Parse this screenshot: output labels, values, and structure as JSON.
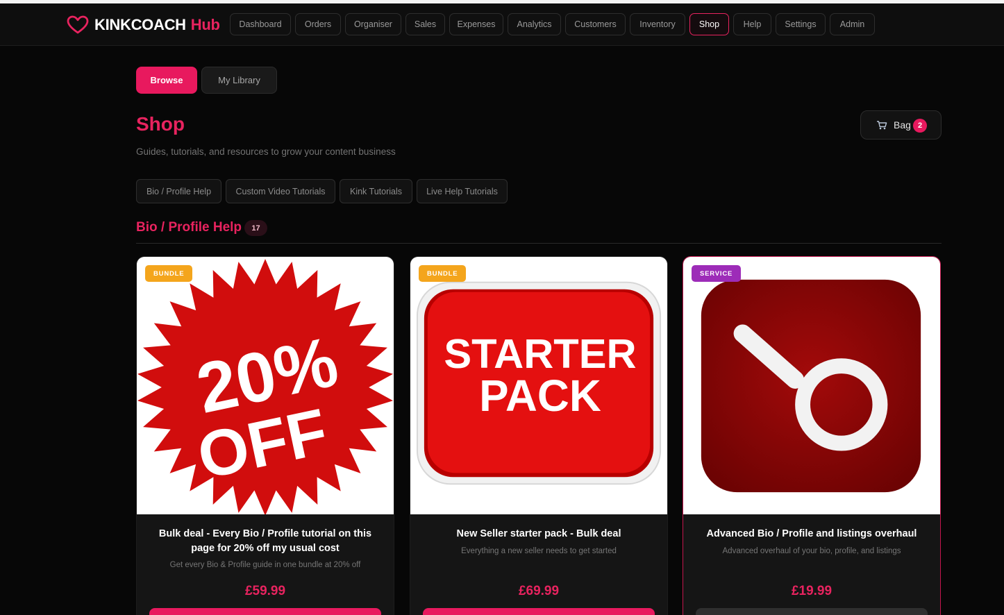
{
  "brand": {
    "name_white": "KINKCOACH",
    "name_pink": "Hub",
    "accent": "#e8235f",
    "icon": "heart-outline-icon"
  },
  "nav": {
    "items": [
      "Dashboard",
      "Orders",
      "Organiser",
      "Sales",
      "Expenses",
      "Analytics",
      "Customers",
      "Inventory",
      "Shop",
      "Help",
      "Settings",
      "Admin"
    ],
    "active": "Shop"
  },
  "tabs": {
    "browse": "Browse",
    "library": "My Library",
    "active": "Browse"
  },
  "page": {
    "title": "Shop",
    "subtitle": "Guides, tutorials, and resources to grow your content business"
  },
  "bag": {
    "label": "Bag",
    "count": "2",
    "icon": "cart-icon"
  },
  "categories": [
    "Bio / Profile Help",
    "Custom Video Tutorials",
    "Kink Tutorials",
    "Live Help Tutorials"
  ],
  "section": {
    "title": "Bio / Profile Help",
    "count": "17"
  },
  "products": [
    {
      "badge": "BUNDLE",
      "image_text": [
        "20%",
        "OFF"
      ],
      "title": "Bulk deal - Every Bio / Profile tutorial on this page for 20% off my usual cost",
      "description": "Get every Bio & Profile guide in one bundle at 20% off",
      "price": "£59.99"
    },
    {
      "badge": "BUNDLE",
      "image_text": [
        "STARTER",
        "PACK"
      ],
      "title": "New Seller starter pack - Bulk deal",
      "description": "Everything a new seller needs to get started",
      "price": "£69.99"
    },
    {
      "badge": "SERVICE",
      "image_text": [],
      "title": "Advanced Bio / Profile and listings overhaul",
      "description": "Advanced overhaul of your bio, profile, and listings",
      "price": "£19.99"
    }
  ],
  "colors": {
    "primary": "#e8195e",
    "bundle_badge": "#f4a51c",
    "service_badge": "#9d2cb8",
    "background": "#070707"
  }
}
